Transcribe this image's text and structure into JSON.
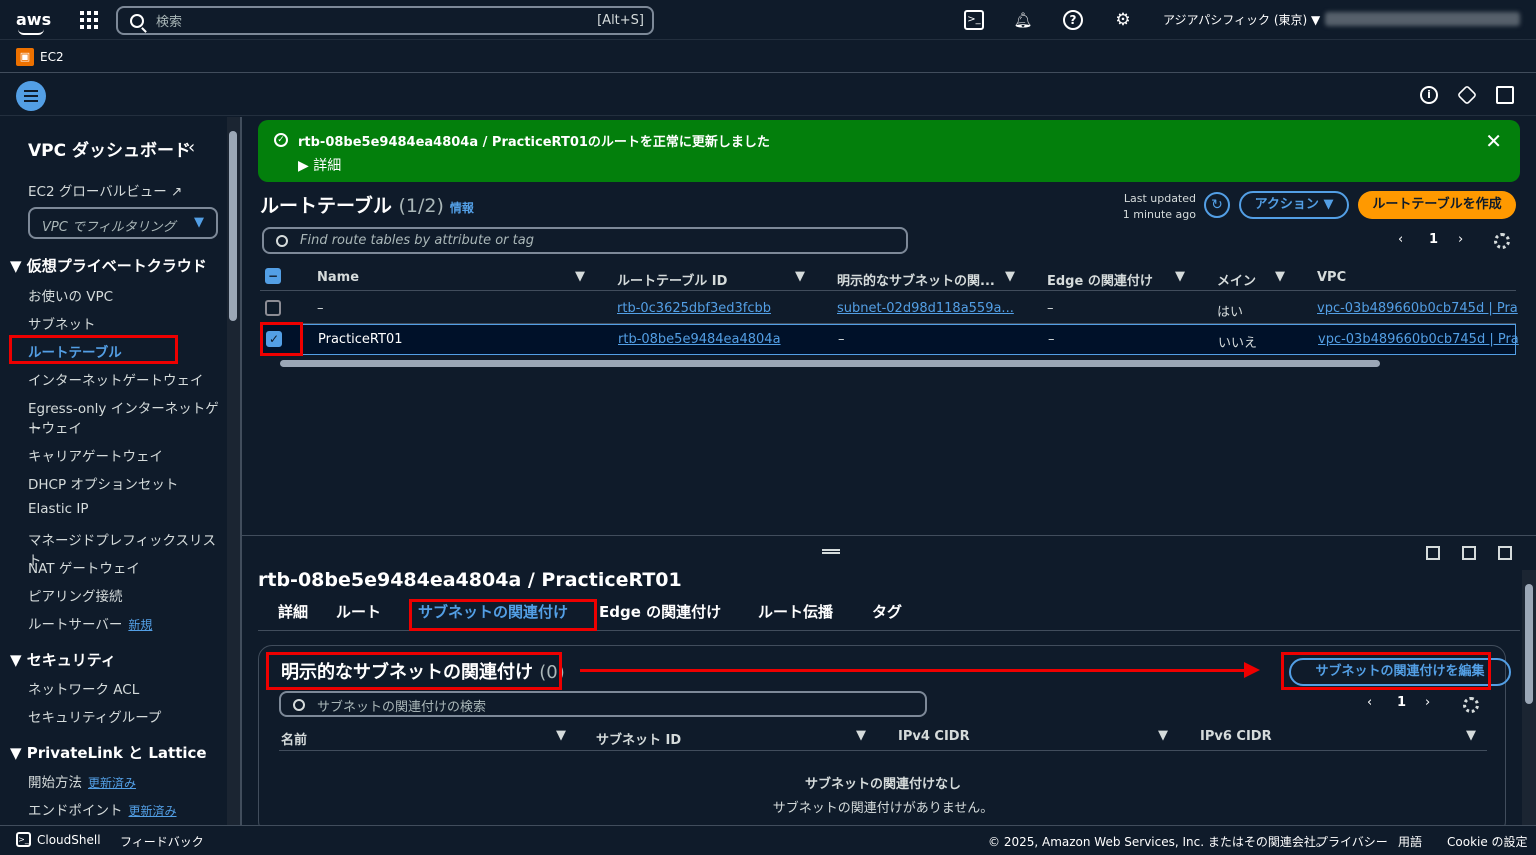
{
  "top": {
    "logo": "aws",
    "search_placeholder": "検索",
    "search_shortcut": "[Alt+S]",
    "region": "アジアパシフィック (東京) ▼"
  },
  "service": {
    "name": "EC2"
  },
  "sidebar": {
    "title": "VPC ダッシュボード",
    "global": "EC2 グローバルビュー",
    "filter_placeholder": "VPC でフィルタリング",
    "sec_vpc": "仮想プライベートクラウド",
    "items": [
      "お使いの VPC",
      "サブネット",
      "ルートテーブル",
      "インターネットゲートウェイ",
      "Egress-only インターネットゲー",
      "トウェイ",
      "キャリアゲートウェイ",
      "DHCP オプションセット",
      "Elastic IP",
      "マネージドプレフィックスリスト",
      "NAT ゲートウェイ",
      "ピアリング接続",
      "ルートサーバー"
    ],
    "new_badge": "新規",
    "sec_security": "セキュリティ",
    "security_items": [
      "ネットワーク ACL",
      "セキュリティグループ"
    ],
    "sec_privatelink": "PrivateLink と Lattice",
    "pl_items": [
      "開始方法",
      "エンドポイント"
    ],
    "updated_badge": "更新済み"
  },
  "flash": {
    "message": "rtb-08be5e9484ea4804a / PracticeRT01のルートを正常に更新しました",
    "details": "詳細"
  },
  "header": {
    "title": "ルートテーブル",
    "count": "(1/2)",
    "info": "情報",
    "last_updated_1": "Last updated",
    "last_updated_2": "1 minute ago",
    "actions": "アクション ▼",
    "create": "ルートテーブルを作成"
  },
  "filter": {
    "placeholder": "Find route tables by attribute or tag"
  },
  "pager": {
    "page": "1"
  },
  "table": {
    "columns": [
      "Name",
      "ルートテーブル ID",
      "明示的なサブネットの関...",
      "Edge の関連付け",
      "メイン",
      "VPC"
    ],
    "rows": [
      {
        "name": "–",
        "id": "rtb-0c3625dbf3ed3fcbb",
        "subnet": "subnet-02d98d118a559a...",
        "edge": "–",
        "main": "はい",
        "vpc": "vpc-03b489660b0cb745d | Pra"
      },
      {
        "name": "PracticeRT01",
        "id": "rtb-08be5e9484ea4804a",
        "subnet": "–",
        "edge": "–",
        "main": "いいえ",
        "vpc": "vpc-03b489660b0cb745d | Pra"
      }
    ]
  },
  "detail": {
    "title": "rtb-08be5e9484ea4804a / PracticeRT01",
    "tabs": [
      "詳細",
      "ルート",
      "サブネットの関連付け",
      "Edge の関連付け",
      "ルート伝播",
      "タグ"
    ],
    "panel_title": "明示的なサブネットの関連付け",
    "panel_count": "(0)",
    "edit": "サブネットの関連付けを編集",
    "search_placeholder": "サブネットの関連付けの検索",
    "page": "1",
    "columns": [
      "名前",
      "サブネット ID",
      "IPv4 CIDR",
      "IPv6 CIDR"
    ],
    "empty_title": "サブネットの関連付けなし",
    "empty_desc": "サブネットの関連付けがありません。"
  },
  "footer": {
    "cloudshell": "CloudShell",
    "feedback": "フィードバック",
    "copyright": "© 2025, Amazon Web Services, Inc. またはその関連会社。",
    "privacy": "プライバシー",
    "terms": "用語",
    "cookie": "Cookie の設定"
  }
}
